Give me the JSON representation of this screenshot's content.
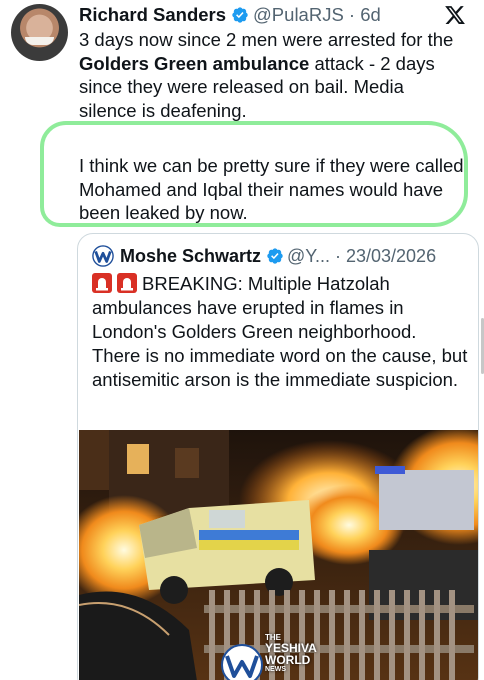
{
  "tweet": {
    "author_name": "Richard Sanders",
    "author_handle": "@PulaRJS · 6d",
    "text_part1": "3 days now since 2 men were arrested for the ",
    "text_bold": "Golders Green ambulance",
    "text_part2": " attack - 2 days since they were released on bail. Media silence is deafening.",
    "text_para2": "I think we can be pretty sure if they were called Mohamed and Iqbal their names would have been leaked by now."
  },
  "quote": {
    "author_name": "Moshe Schwartz",
    "author_handle": "@Y... · 23/03/2026",
    "text": "BREAKING: Multiple Hatzolah ambulances have erupted in flames in London's Golders Green neighborhood. There is no immediate word on the cause, but antisemitic arson is the immediate suspicion.",
    "watermark": {
      "line1": "THE",
      "line2": "YESHIVA",
      "line3": "WORLD",
      "line4": "NEWS"
    }
  },
  "icons": {
    "verified": "verified-badge-icon",
    "x_logo": "x-logo-icon",
    "siren": "police-light-icon"
  },
  "colors": {
    "verified_blue": "#1d9bf0",
    "highlight_green": "#8fec9a",
    "secondary_text": "#536471"
  }
}
